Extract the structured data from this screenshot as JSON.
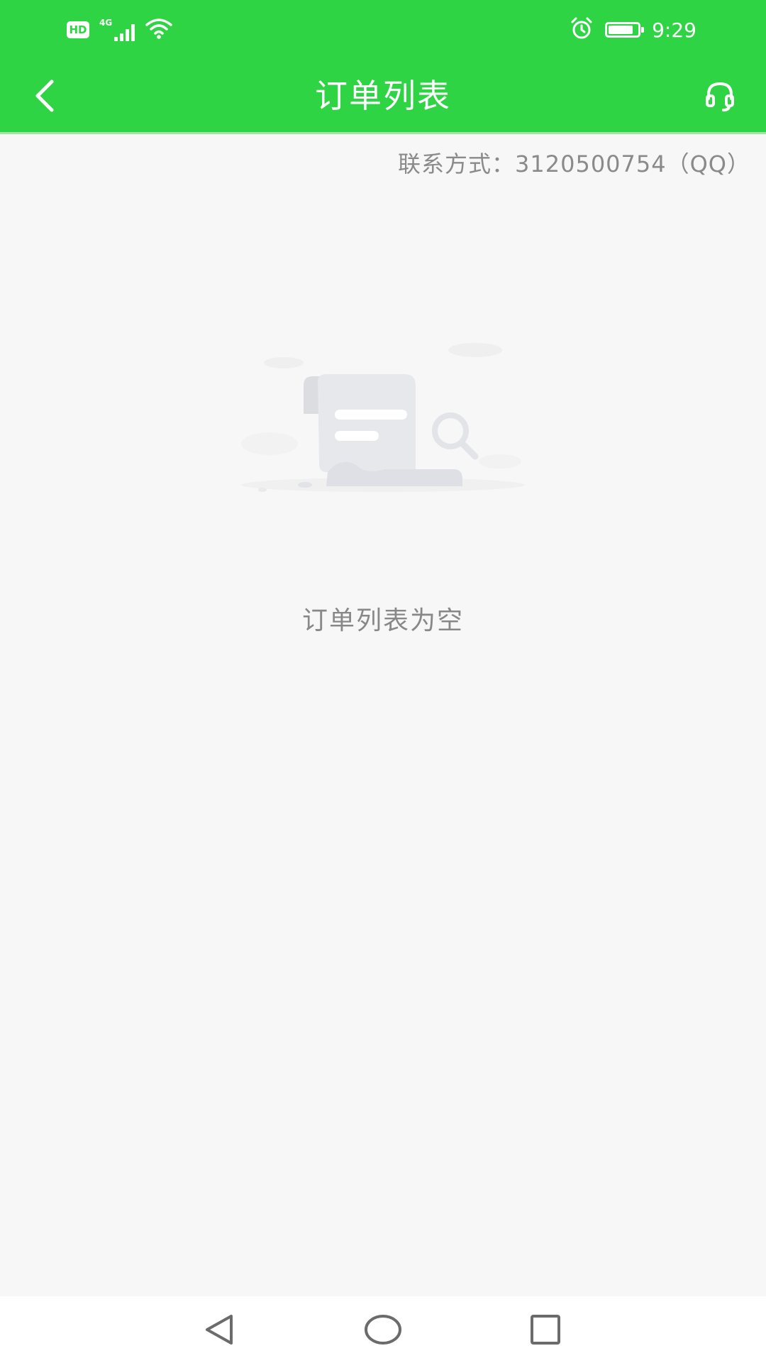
{
  "status_bar": {
    "hd_label": "HD",
    "network_label": "4G",
    "time": "9:29",
    "battery_level": 0.85,
    "icons": [
      "hd-icon",
      "signal-icon",
      "wifi-icon",
      "alarm-icon",
      "battery-icon"
    ]
  },
  "app_bar": {
    "title": "订单列表",
    "back_icon": "chevron-left-icon",
    "support_icon": "headset-icon"
  },
  "contact": {
    "text": "联系方式：3120500754（QQ）"
  },
  "empty_state": {
    "illustration_icon": "empty-document-icon",
    "message": "订单列表为空"
  },
  "nav_bar": {
    "buttons": [
      "back-triangle-icon",
      "home-circle-icon",
      "recents-square-icon"
    ]
  },
  "colors": {
    "primary_green": "#2fd444",
    "background": "#f7f7f7",
    "secondary_text": "#8a8a8a"
  }
}
